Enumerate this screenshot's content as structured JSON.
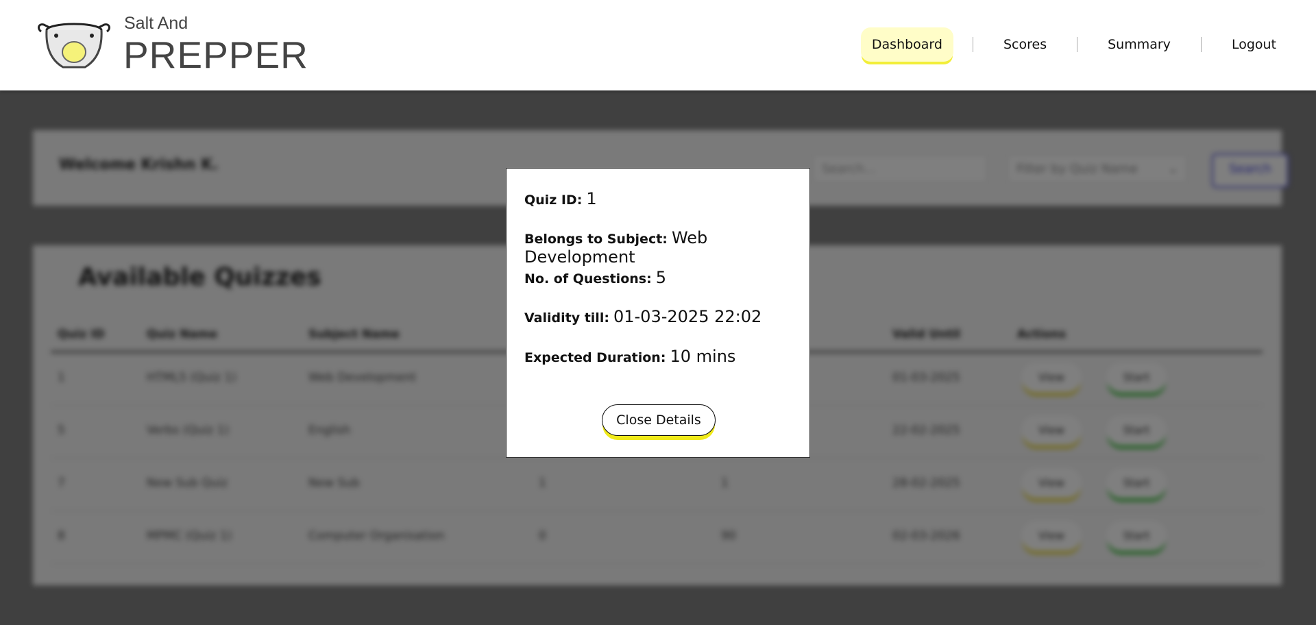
{
  "header": {
    "brand_small": "Salt And",
    "brand_big": "PREPPER",
    "nav": [
      {
        "label": "Dashboard",
        "active": true
      },
      {
        "label": "Scores",
        "active": false
      },
      {
        "label": "Summary",
        "active": false
      },
      {
        "label": "Logout",
        "active": false
      }
    ]
  },
  "dashboard": {
    "welcome": "Welcome Krishn K.",
    "search_placeholder": "Search...",
    "filter_placeholder": "Filter by Quiz Name",
    "search_button": "Search",
    "quizzes_title": "Available Quizzes",
    "columns": [
      "Quiz ID",
      "Quiz Name",
      "Subject Name",
      "",
      "",
      "Valid Until",
      "Actions"
    ],
    "rows": [
      {
        "id": "1",
        "name": "HTML5 (Quiz 1)",
        "subject": "Web Development",
        "c3": "",
        "c4": "",
        "valid": "01-03-2025"
      },
      {
        "id": "5",
        "name": "Verbs (Quiz 1)",
        "subject": "English",
        "c3": "",
        "c4": "",
        "valid": "22-02-2025"
      },
      {
        "id": "7",
        "name": "New Sub Quiz",
        "subject": "New Sub",
        "c3": "1",
        "c4": "1",
        "valid": "28-02-2025"
      },
      {
        "id": "8",
        "name": "MPMC (Quiz 1)",
        "subject": "Computer Organisation",
        "c3": "0",
        "c4": "90",
        "valid": "02-03-2026"
      }
    ],
    "view_label": "View",
    "start_label": "Start"
  },
  "modal": {
    "quiz_id_label": "Quiz ID:",
    "quiz_id": "1",
    "subject_label": "Belongs to Subject:",
    "subject": "Web Development",
    "questions_label": "No. of Questions:",
    "questions": "5",
    "validity_label": "Validity till:",
    "validity": "01-03-2025 22:02",
    "duration_label": "Expected Duration:",
    "duration": "10 mins",
    "close_label": "Close Details"
  },
  "colors": {
    "active_nav_bg": "#fffdc8",
    "accent_yellow": "#f0ea1a",
    "accent_green": "#3cbf3c",
    "search_blue": "#3b3bd6"
  }
}
